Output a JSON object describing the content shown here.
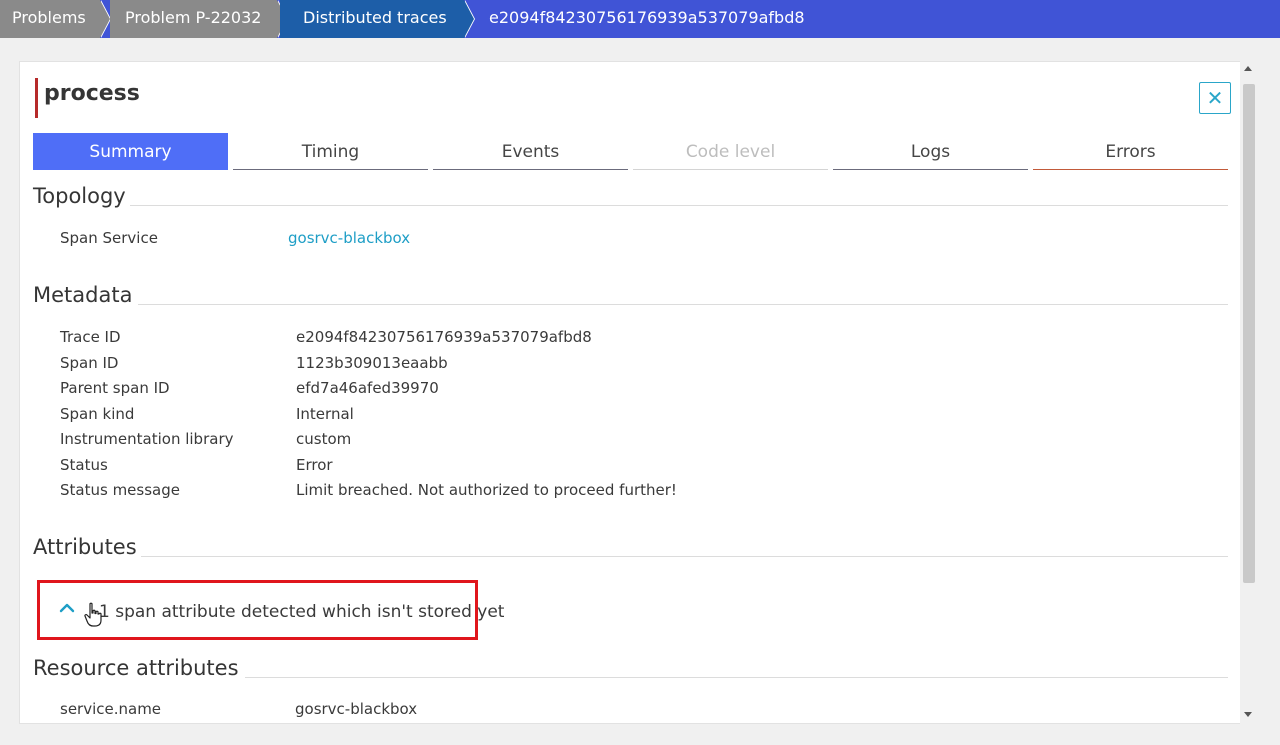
{
  "breadcrumb": {
    "items": [
      "Problems",
      "Problem P-22032",
      "Distributed traces",
      "e2094f84230756176939a537079afbd8"
    ]
  },
  "panel": {
    "title": "process",
    "close_label": "✕"
  },
  "tabs": [
    {
      "label": "Summary",
      "state": "active"
    },
    {
      "label": "Timing",
      "state": "normal"
    },
    {
      "label": "Events",
      "state": "normal"
    },
    {
      "label": "Code level",
      "state": "disabled"
    },
    {
      "label": "Logs",
      "state": "normal"
    },
    {
      "label": "Errors",
      "state": "normal"
    }
  ],
  "topology": {
    "heading": "Topology",
    "rows": [
      {
        "key": "Span Service",
        "value": "gosrvc-blackbox"
      }
    ]
  },
  "metadata": {
    "heading": "Metadata",
    "rows": [
      {
        "key": "Trace ID",
        "value": "e2094f84230756176939a537079afbd8"
      },
      {
        "key": "Span ID",
        "value": "1123b309013eaabb"
      },
      {
        "key": "Parent span ID",
        "value": "efd7a46afed39970"
      },
      {
        "key": "Span kind",
        "value": "Internal"
      },
      {
        "key": "Instrumentation library",
        "value": "custom"
      },
      {
        "key": "Status",
        "value": "Error"
      },
      {
        "key": "Status message",
        "value": "Limit breached. Not authorized to proceed further!"
      }
    ]
  },
  "attributes": {
    "heading": "Attributes",
    "expander_text": "1 span attribute detected which isn't stored yet"
  },
  "resource_attributes": {
    "heading": "Resource attributes",
    "rows": [
      {
        "key": "service.name",
        "value": "gosrvc-blackbox"
      }
    ]
  },
  "colors": {
    "breadcrumb_active": "#4054d6",
    "breadcrumb_gray": "#8a8a8a",
    "breadcrumb_blue": "#1d5ea8",
    "tab_active": "#4f6ef7",
    "link": "#1e9ec6",
    "highlight": "#e0161c",
    "title_accent": "#b62a2a"
  },
  "icons": {
    "close": "close-icon",
    "expander": "chevron-up-icon",
    "cursor": "hand-pointer-icon"
  }
}
